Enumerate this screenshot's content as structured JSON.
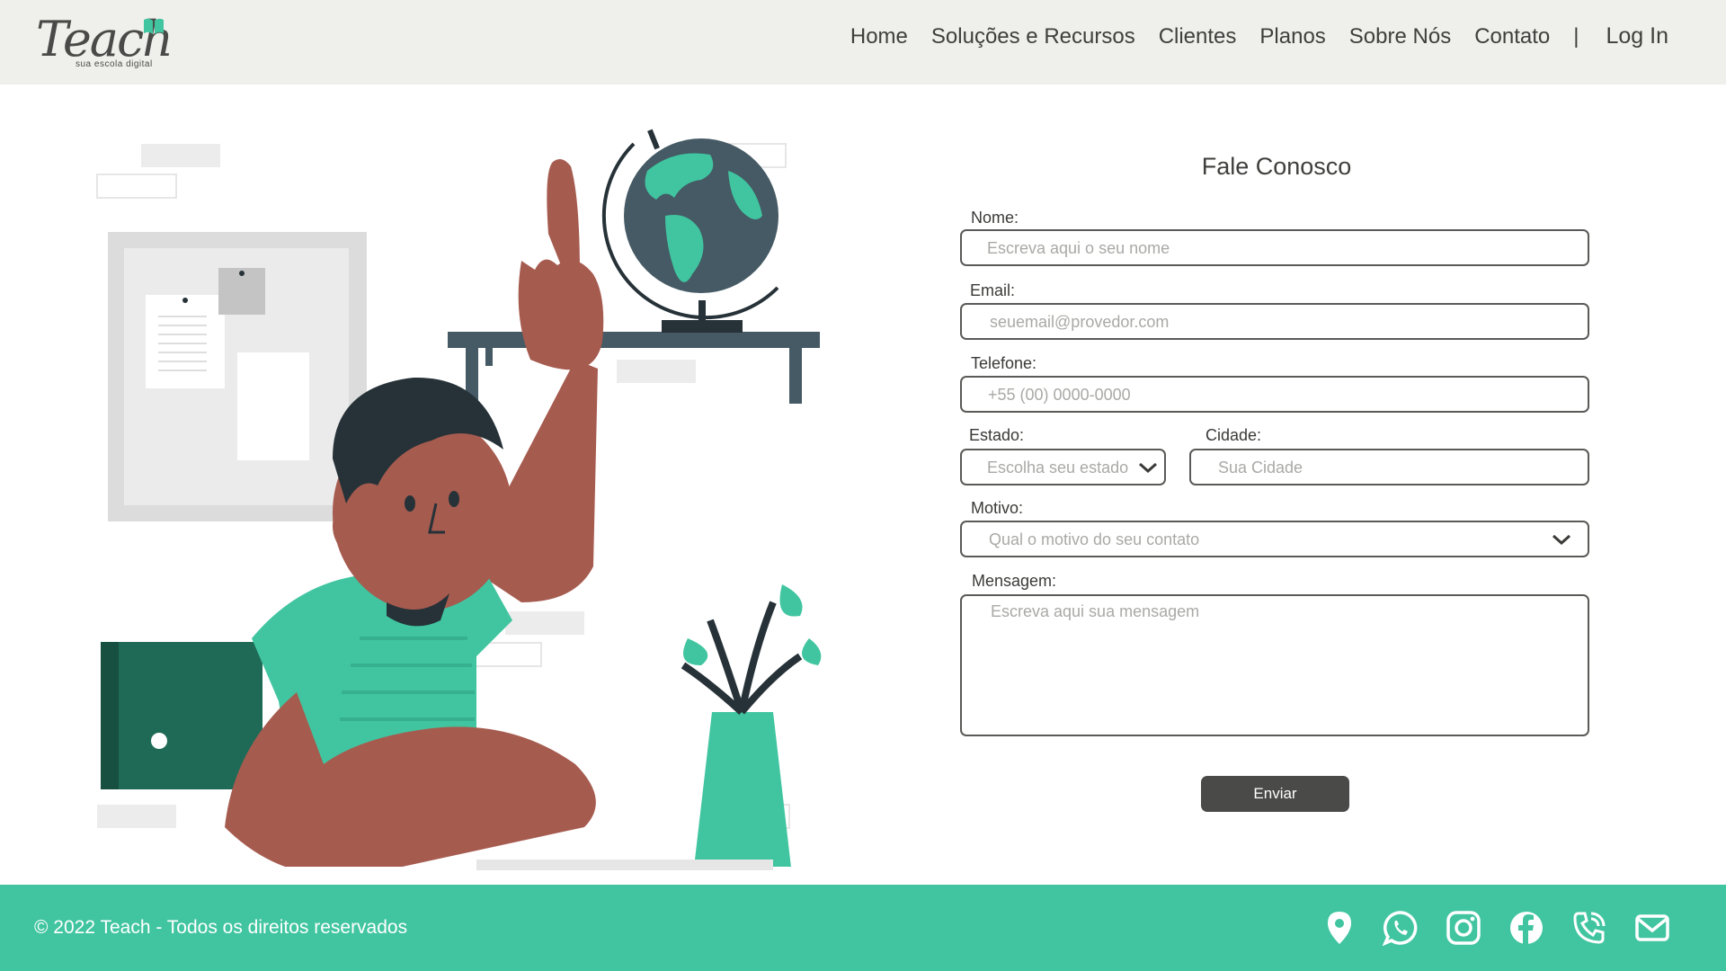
{
  "logo": {
    "word": "Teach",
    "tagline": "sua escola digital"
  },
  "nav": {
    "items": [
      "Home",
      "Soluções e Recursos",
      "Clientes",
      "Planos",
      "Sobre Nós",
      "Contato"
    ],
    "separator": "|",
    "login": "Log In"
  },
  "form": {
    "title": "Fale Conosco",
    "nome": {
      "label": "Nome:",
      "placeholder": "Escreva aqui o seu nome"
    },
    "email": {
      "label": "Email:",
      "placeholder": "seuemail@provedor.com"
    },
    "telefone": {
      "label": "Telefone:",
      "placeholder": "+55 (00) 0000-0000"
    },
    "estado": {
      "label": "Estado:",
      "placeholder": "Escolha seu estado"
    },
    "cidade": {
      "label": "Cidade:",
      "placeholder": "Sua Cidade"
    },
    "motivo": {
      "label": "Motivo:",
      "placeholder": "Qual o motivo do seu contato"
    },
    "mensagem": {
      "label": "Mensagem:",
      "placeholder": "Escreva aqui sua mensagem"
    },
    "submit": "Enviar"
  },
  "footer": {
    "copyright": "© 2022 Teach - Todos os direitos reservados",
    "icons": [
      "location-icon",
      "whatsapp-icon",
      "instagram-icon",
      "facebook-icon",
      "phone-icon",
      "mail-icon"
    ]
  },
  "colors": {
    "accent": "#40c5a0",
    "header_bg": "#efefeb",
    "text": "#4a4a48",
    "skin": "#a65b4f",
    "hair": "#263238"
  }
}
